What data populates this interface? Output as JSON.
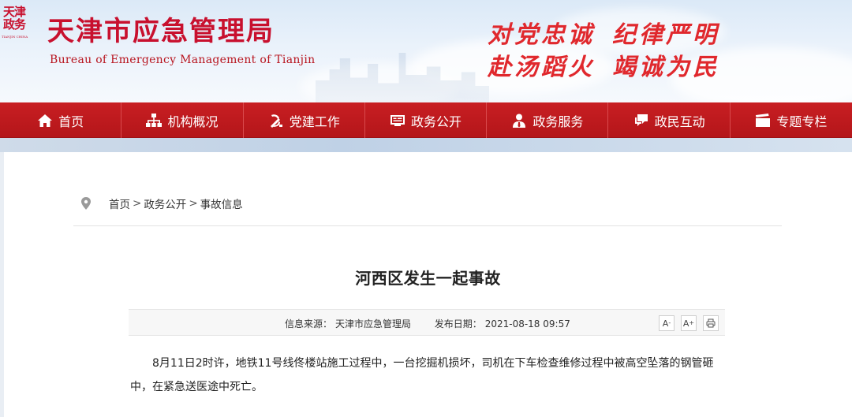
{
  "header": {
    "emblem_line1": "天津",
    "emblem_line2": "政务",
    "emblem_caption": "TIANJIN CHINA",
    "title": "天津市应急管理局",
    "subtitle": "Bureau of Emergency Management of Tianjin",
    "slogan_line1_a": "对党忠诚",
    "slogan_line1_b": "纪律严明",
    "slogan_line2_a": "赴汤蹈火",
    "slogan_line2_b": "竭诚为民"
  },
  "nav": {
    "items": [
      {
        "label": "首页",
        "icon": "home-icon"
      },
      {
        "label": "机构概况",
        "icon": "org-chart-icon"
      },
      {
        "label": "党建工作",
        "icon": "party-emblem-icon"
      },
      {
        "label": "政务公开",
        "icon": "board-icon"
      },
      {
        "label": "政务服务",
        "icon": "user-service-icon"
      },
      {
        "label": "政民互动",
        "icon": "chat-icon"
      },
      {
        "label": "专题专栏",
        "icon": "clapperboard-icon"
      }
    ]
  },
  "breadcrumb": {
    "items": [
      "首页",
      "政务公开",
      "事故信息"
    ],
    "separator": ">"
  },
  "article": {
    "title": "河西区发生一起事故",
    "source_label": "信息来源：",
    "source_value": "天津市应急管理局",
    "date_label": "发布日期：",
    "date_value": "2021-08-18 09:57",
    "font_decrease_label": "A",
    "font_increase_label": "A",
    "body": "8月11日2时许，地铁11号线佟楼站施工过程中，一台挖掘机损坏，司机在下车检查维修过程中被高空坠落的钢管砸中，在紧急送医途中死亡。"
  },
  "colors": {
    "brand_red": "#c8102e",
    "nav_red": "#c01a1e",
    "slogan_red": "#e0282d"
  }
}
